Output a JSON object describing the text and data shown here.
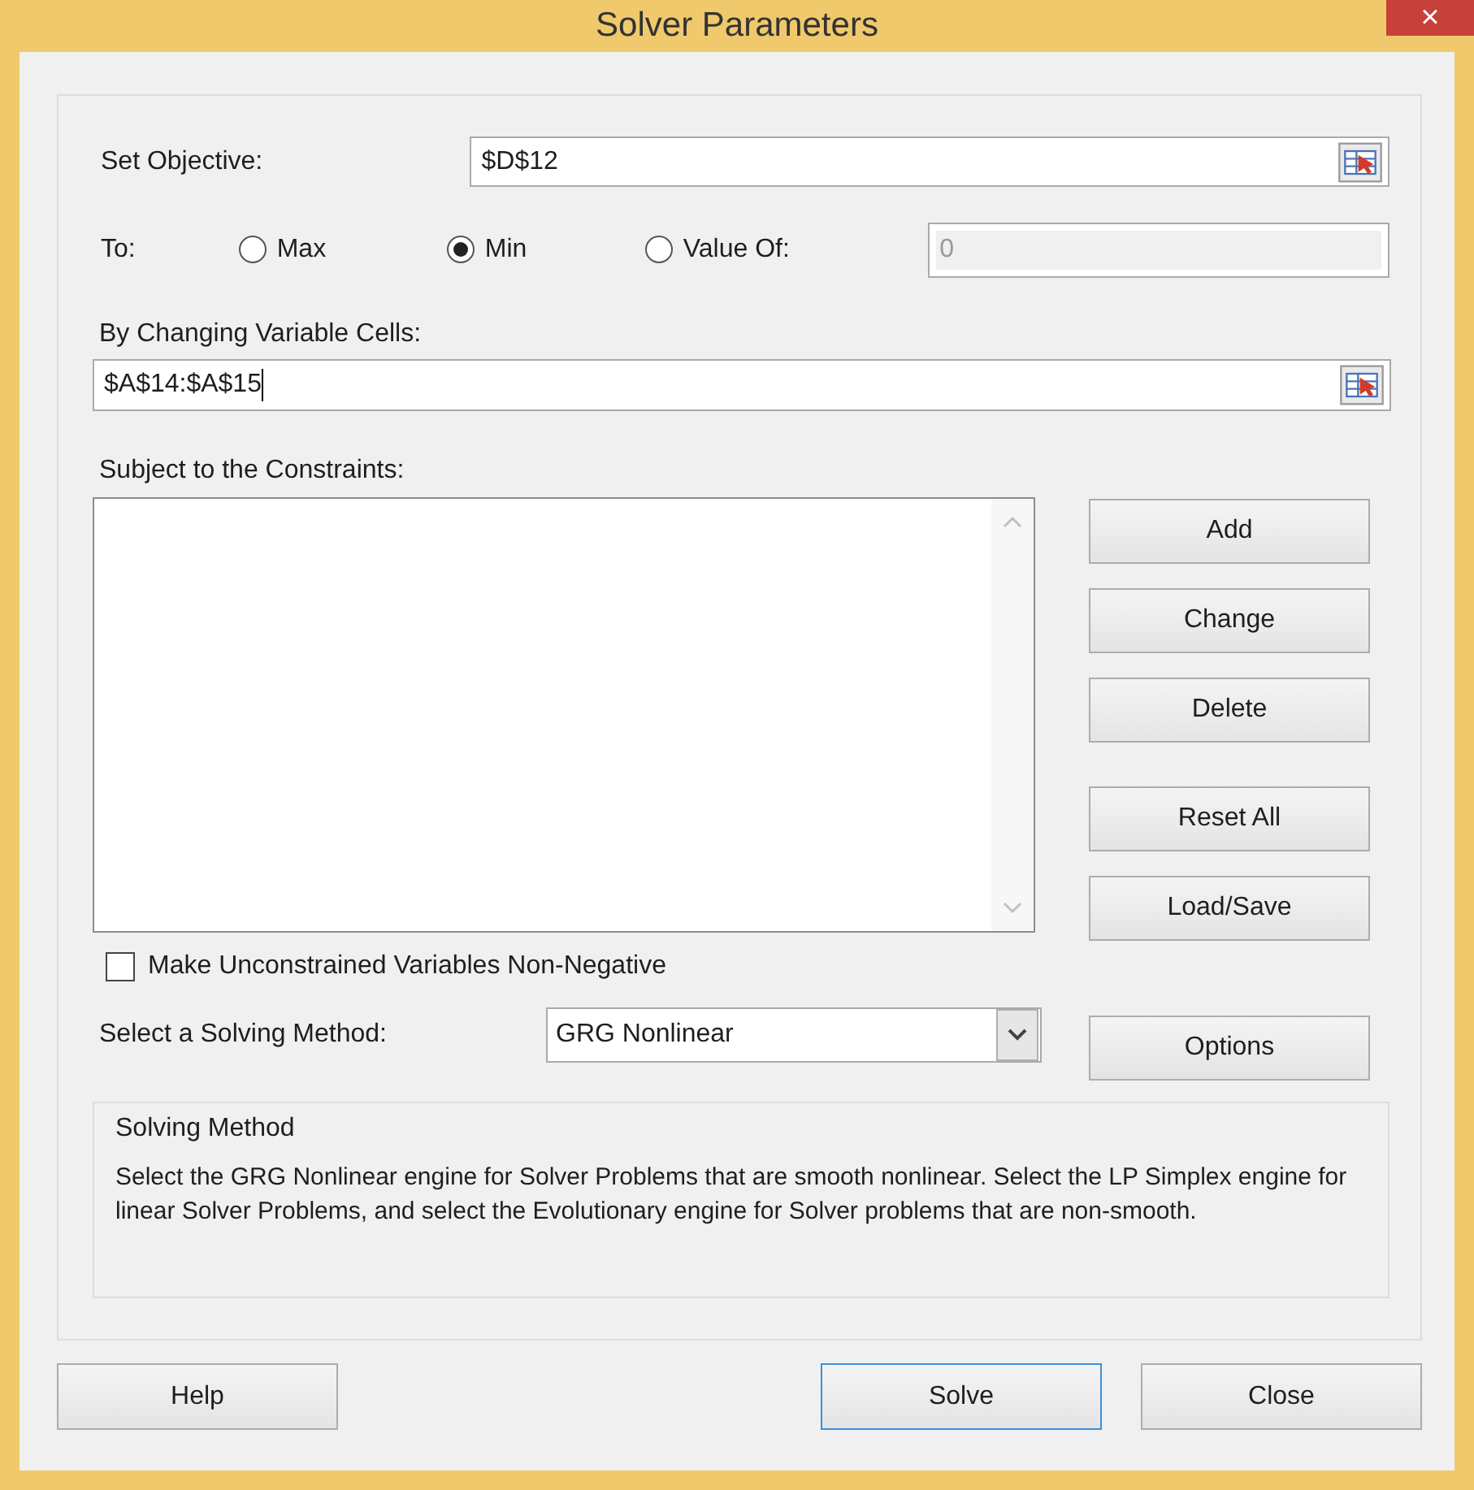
{
  "window": {
    "title": "Solver Parameters",
    "close": "×"
  },
  "objective": {
    "label": "Set Objective:",
    "value": "$D$12"
  },
  "to": {
    "label": "To:",
    "options": [
      {
        "label": "Max",
        "selected": false
      },
      {
        "label": "Min",
        "selected": true
      },
      {
        "label": "Value Of:",
        "selected": false
      }
    ],
    "value_field": {
      "value": "0",
      "disabled": true
    }
  },
  "changing_cells": {
    "label": "By Changing Variable Cells:",
    "value": "$A$14:$A$15"
  },
  "constraints": {
    "label": "Subject to the Constraints:",
    "buttons": [
      "Add",
      "Change",
      "Delete",
      "Reset All",
      "Load/Save"
    ]
  },
  "non_negative": {
    "label": "Make Unconstrained Variables Non-Negative",
    "checked": false
  },
  "method": {
    "label": "Select a Solving Method:",
    "value": "GRG Nonlinear",
    "button": "Options"
  },
  "description": {
    "title": "Solving Method",
    "text": "Select the GRG Nonlinear engine for Solver Problems that are smooth nonlinear. Select the LP Simplex engine for linear Solver Problems, and select the Evolutionary engine for Solver problems that are non-smooth."
  },
  "footer_buttons": [
    {
      "label": "Help",
      "default": false
    },
    {
      "label": "Solve",
      "default": true
    },
    {
      "label": "Close",
      "default": false
    }
  ]
}
